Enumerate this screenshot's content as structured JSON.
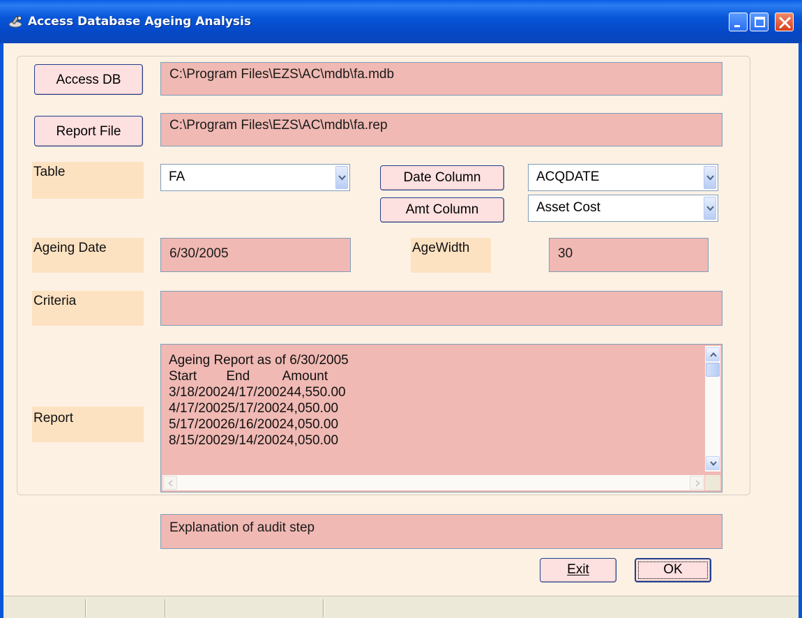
{
  "window": {
    "title": "Access Database Ageing Analysis",
    "icon": "app-icon"
  },
  "buttons": {
    "access_db": "Access DB",
    "report_file": "Report File",
    "date_column": "Date Column",
    "amt_column": "Amt Column",
    "exit": "Exit",
    "ok": "OK"
  },
  "fields": {
    "access_db_path": "C:\\Program Files\\EZS\\AC\\mdb\\fa.mdb",
    "report_file_path": "C:\\Program Files\\EZS\\AC\\mdb\\fa.rep",
    "ageing_date": "6/30/2005",
    "age_width": "30",
    "criteria": "",
    "explanation": "Explanation of audit step"
  },
  "labels": {
    "table": "Table",
    "ageing_date": "Ageing Date",
    "age_width": "AgeWidth",
    "criteria": "Criteria",
    "report": "Report"
  },
  "combos": {
    "table": "FA",
    "date_column": "ACQDATE",
    "amt_column": "Asset Cost"
  },
  "report": {
    "lines": [
      "Ageing Report as of 6/30/2005",
      "Start        End         Amount",
      "3/18/20024/17/200244,550.00",
      "4/17/20025/17/20024,050.00",
      "5/17/20026/16/20024,050.00",
      "8/15/20029/14/20024,050.00"
    ]
  },
  "colors": {
    "titlebar": "#0756d8",
    "client_bg": "#fdf1e4",
    "field_bg": "#f0b9b3",
    "label_bg": "#fde2c2",
    "button_bg": "#fde0e0"
  }
}
